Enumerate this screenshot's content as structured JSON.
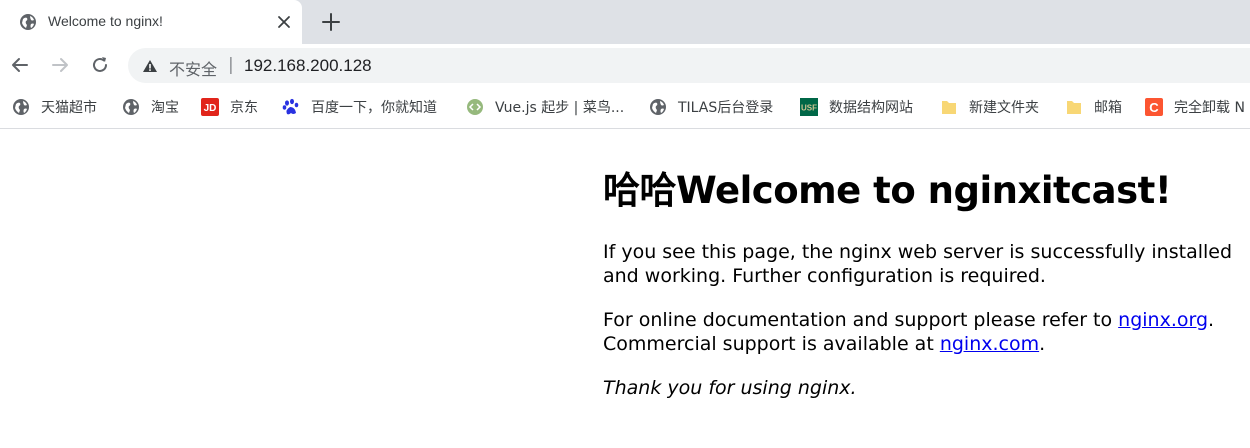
{
  "tab": {
    "title": "Welcome to nginx!"
  },
  "address": {
    "security_label": "不安全",
    "separator": "|",
    "url": "192.168.200.128"
  },
  "bookmarks": [
    {
      "label": "天猫超市",
      "icon": "globe-icon"
    },
    {
      "label": "淘宝",
      "icon": "globe-icon"
    },
    {
      "label": "京东",
      "icon": "jd-icon"
    },
    {
      "label": "百度一下，你就知道",
      "icon": "baidu-paw-icon"
    },
    {
      "label": "Vue.js 起步 | 菜鸟...",
      "icon": "runoob-icon"
    },
    {
      "label": "TILAS后台登录",
      "icon": "globe-icon"
    },
    {
      "label": "数据结构网站",
      "icon": "usf-icon"
    },
    {
      "label": "新建文件夹",
      "icon": "folder-icon"
    },
    {
      "label": "邮箱",
      "icon": "folder-icon"
    },
    {
      "label": "完全卸载 N",
      "icon": "csdn-icon"
    }
  ],
  "icons": {
    "jd_text": "JD",
    "usf_text": "USF",
    "csdn_text": "C"
  },
  "page": {
    "heading": "哈哈Welcome to nginxitcast!",
    "p1": "If you see this page, the nginx web server is successfully installed and working. Further configuration is required.",
    "p2_prefix": "For online documentation and support please refer to ",
    "p2_link": "nginx.org",
    "p2_mid": ".",
    "p2_line2": "Commercial support is available at ",
    "p2_link2": "nginx.com",
    "p2_end": ".",
    "p3": "Thank you for using nginx."
  },
  "colors": {
    "link": "#0000ee",
    "tabstrip": "#dee1e6",
    "omnibox": "#f1f3f4"
  }
}
